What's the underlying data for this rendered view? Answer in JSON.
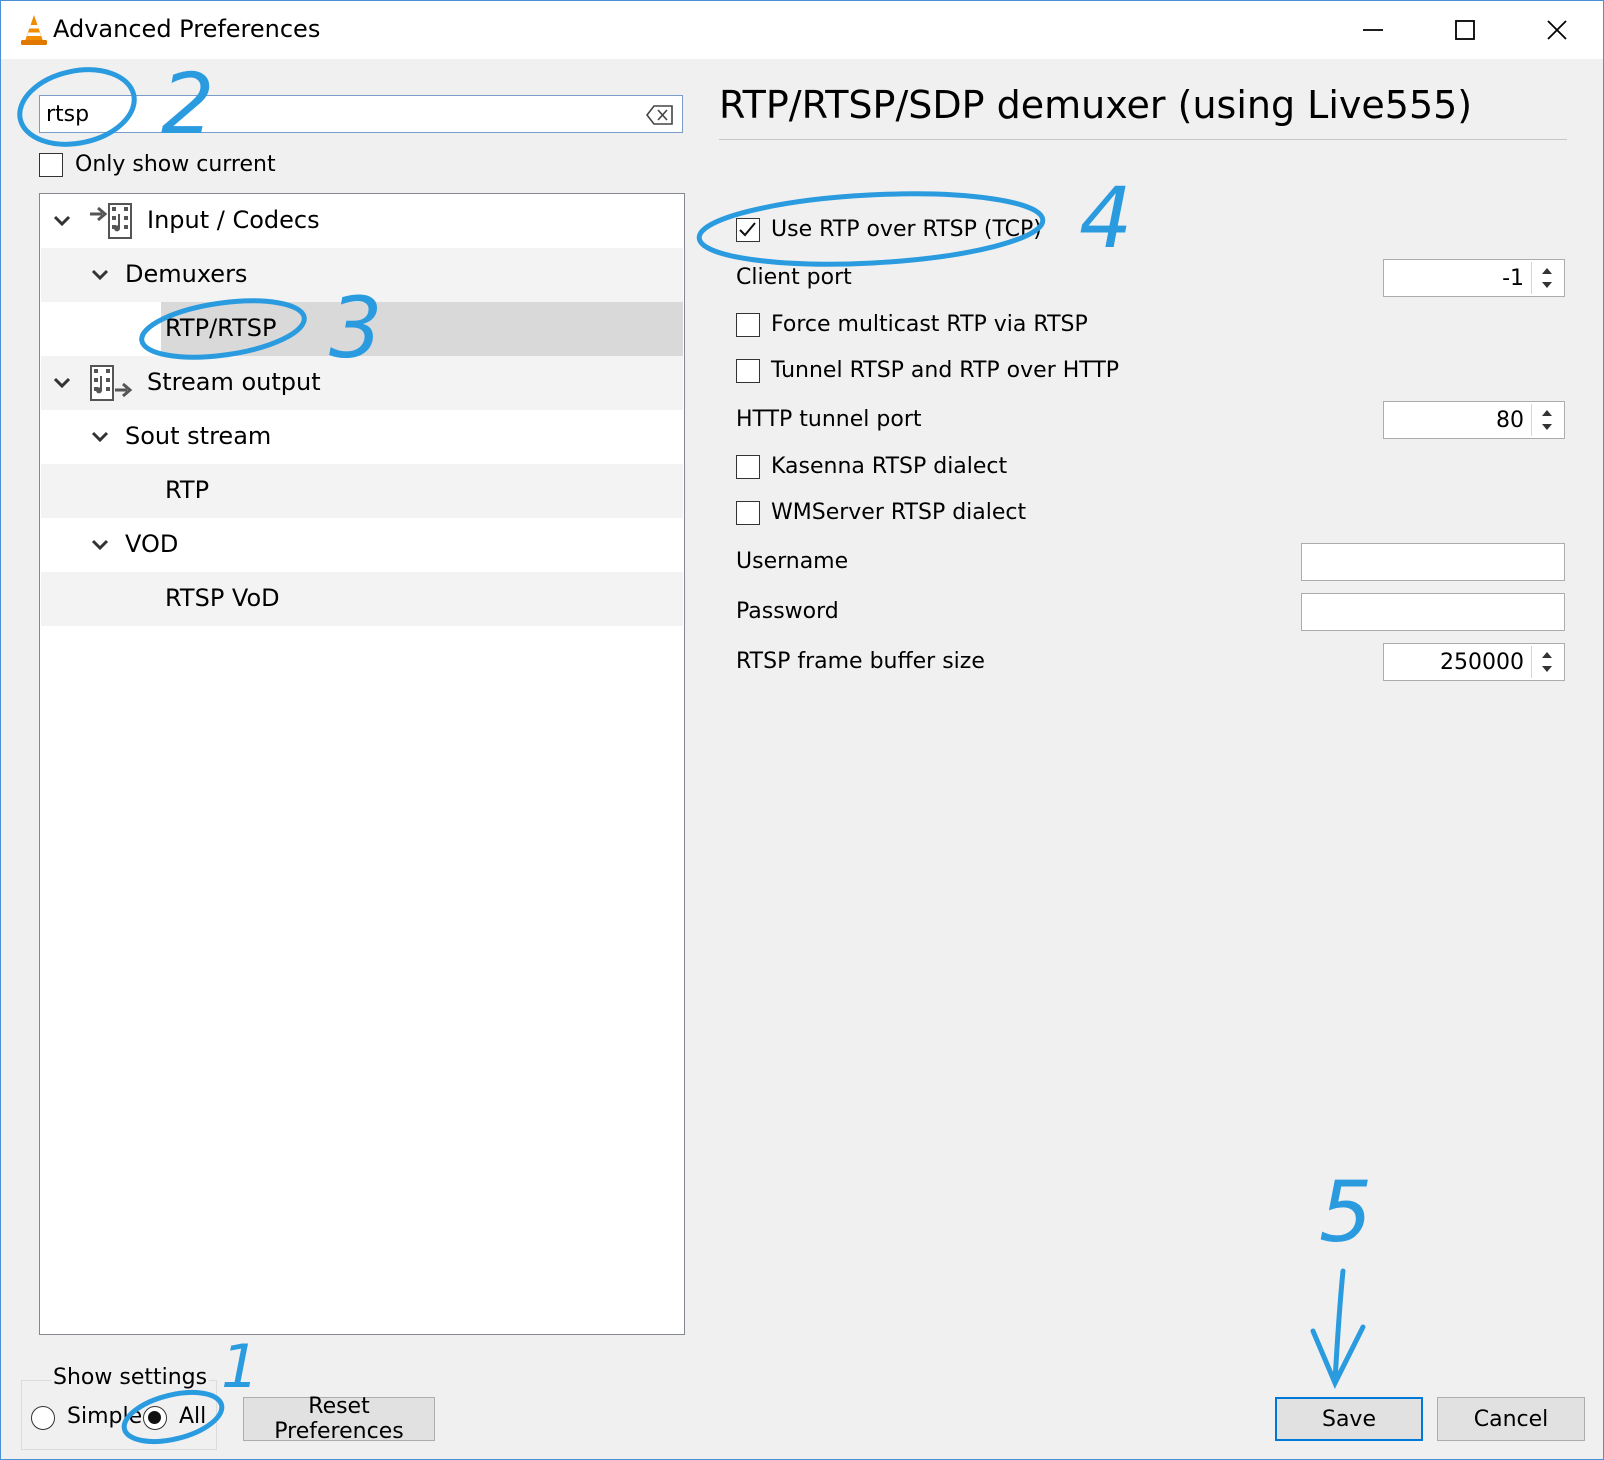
{
  "window": {
    "title": "Advanced Preferences",
    "controls": {
      "minimize": "minimize",
      "maximize": "maximize",
      "close": "close"
    }
  },
  "search": {
    "value": "rtsp",
    "only_show_current": "Only show current",
    "only_show_current_checked": false
  },
  "tree": {
    "items": [
      {
        "label": "Input / Codecs",
        "icon": "input-codecs-icon",
        "level": 0,
        "expanded": true
      },
      {
        "label": "Demuxers",
        "level": 1,
        "expanded": true
      },
      {
        "label": "RTP/RTSP",
        "level": 2,
        "selected": true
      },
      {
        "label": "Stream output",
        "icon": "stream-output-icon",
        "level": 0,
        "expanded": true
      },
      {
        "label": "Sout stream",
        "level": 1,
        "expanded": true
      },
      {
        "label": "RTP",
        "level": 2
      },
      {
        "label": "VOD",
        "level": 1,
        "expanded": true
      },
      {
        "label": "RTSP VoD",
        "level": 2
      }
    ]
  },
  "show_settings": {
    "label": "Show settings",
    "simple": "Simple",
    "all": "All",
    "selected": "All"
  },
  "buttons": {
    "reset": "Reset Preferences",
    "save": "Save",
    "cancel": "Cancel"
  },
  "panel": {
    "title": "RTP/RTSP/SDP demuxer (using Live555)",
    "options": {
      "use_rtp_over_rtsp": {
        "label": "Use RTP over RTSP (TCP)",
        "checked": true
      },
      "client_port": {
        "label": "Client port",
        "value": "-1"
      },
      "force_multicast": {
        "label": "Force multicast RTP via RTSP",
        "checked": false
      },
      "tunnel_http": {
        "label": "Tunnel RTSP and RTP over HTTP",
        "checked": false
      },
      "http_tunnel_port": {
        "label": "HTTP tunnel port",
        "value": "80"
      },
      "kasenna": {
        "label": "Kasenna RTSP dialect",
        "checked": false
      },
      "wmserver": {
        "label": "WMServer RTSP dialect",
        "checked": false
      },
      "username": {
        "label": "Username",
        "value": ""
      },
      "password": {
        "label": "Password",
        "value": ""
      },
      "frame_buffer": {
        "label": "RTSP frame buffer size",
        "value": "250000"
      }
    }
  },
  "annotations": {
    "step1": "1",
    "step2": "2",
    "step3": "3",
    "step4": "4",
    "step5": "5",
    "color": "#2b9be0"
  },
  "colors": {
    "accent": "#0078d7",
    "selection": "#d9d9d9",
    "vlc_orange": "#f08c00"
  }
}
